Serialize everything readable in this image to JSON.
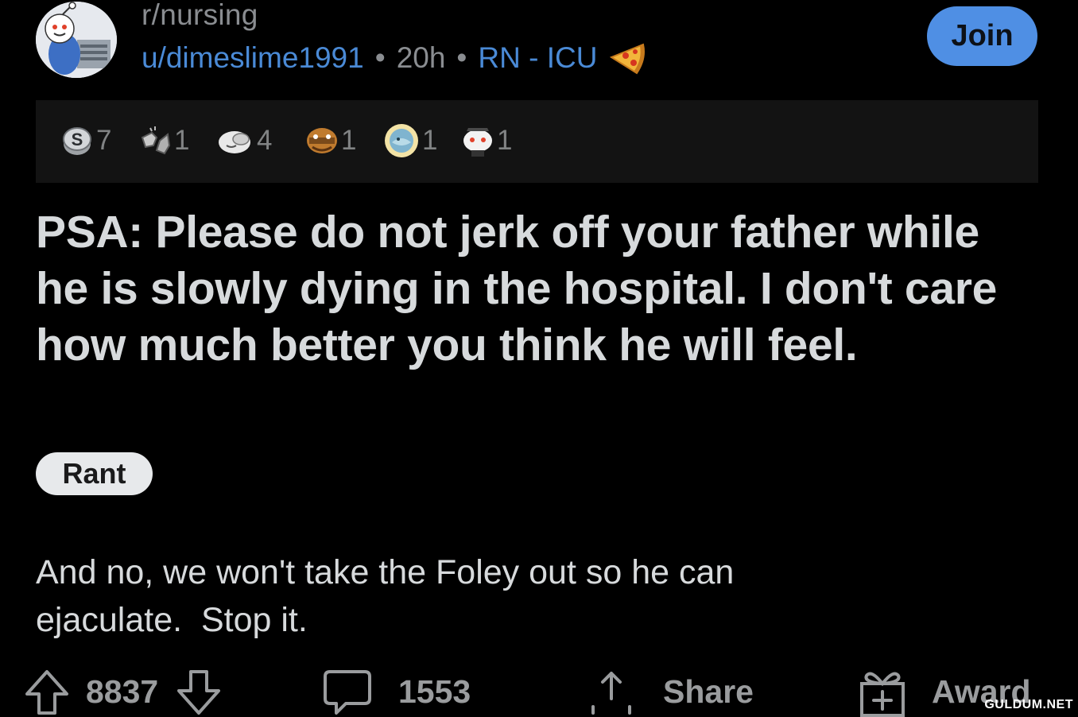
{
  "header": {
    "subreddit": "r/nursing",
    "username": "u/dimeslime1991",
    "separator": "•",
    "time_ago": "20h",
    "user_flair": "RN - ICU",
    "flair_icon": "pizza-icon",
    "join_label": "Join",
    "avatar_icon": "snoo-avatar-icon"
  },
  "awards": [
    {
      "icon": "silver-coin-icon",
      "count": "7"
    },
    {
      "icon": "fist-bump-icon",
      "count": "1"
    },
    {
      "icon": "facepalm-icon",
      "count": "4"
    },
    {
      "icon": "face-with-mask-icon",
      "count": "1"
    },
    {
      "icon": "sun-face-icon",
      "count": "1"
    },
    {
      "icon": "snoo-award-icon",
      "count": "1"
    }
  ],
  "post": {
    "title": "PSA: Please do not jerk off your father while he is slowly dying in the hospital. I don't care how much better you think he will feel.",
    "flair": "Rant",
    "body_line1": "And no, we won't take the Foley out so he can",
    "body_line2": "ejaculate.  Stop it."
  },
  "actions": {
    "upvotes": "8837",
    "comments": "1553",
    "share_label": "Share",
    "award_label": "Award"
  },
  "watermark": "GULDUM.NET",
  "colors": {
    "background": "#000000",
    "accent_blue": "#4f8fe4",
    "link_blue": "#4a8ad6",
    "text": "#d7dadc",
    "muted": "#8a8d91"
  }
}
